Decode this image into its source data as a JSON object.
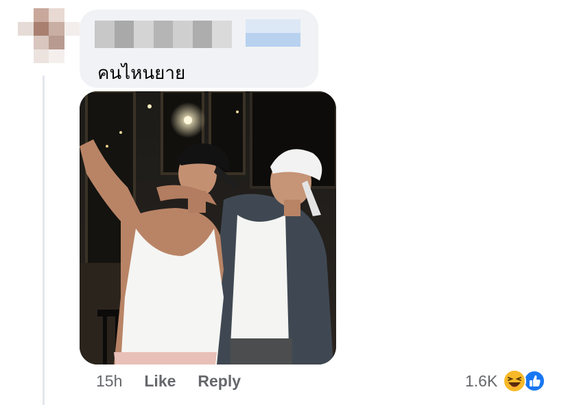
{
  "comment": {
    "text": "คนไหนยาย",
    "image_alt": "Two men in white shirts and caps posing at night"
  },
  "actions": {
    "timestamp": "15h",
    "like_label": "Like",
    "reply_label": "Reply"
  },
  "reactions": {
    "count": "1.6K",
    "icons": [
      "haha-icon",
      "like-icon"
    ]
  },
  "colors": {
    "bubble": "#f0f2f5",
    "secondary_text": "#65676b",
    "like_blue": "#1877f2",
    "haha_yellow": "#f7b928"
  }
}
